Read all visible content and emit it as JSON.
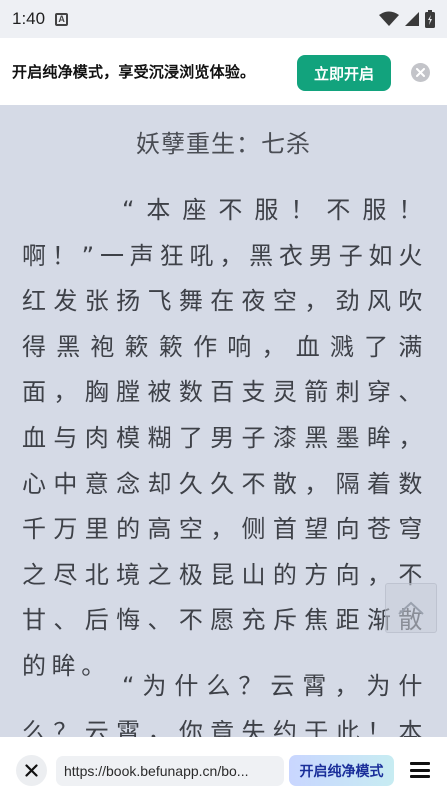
{
  "status_bar": {
    "time": "1:40",
    "notification_icon_letter": "A",
    "icons": [
      "wifi-icon",
      "signal-icon",
      "battery-icon"
    ]
  },
  "promo": {
    "text": "开启纯净模式，享受沉浸浏览体验。",
    "button_label": "立即开启",
    "accent_color": "#12a37d"
  },
  "reader": {
    "chapter_title": "妖孽重生：七杀",
    "paragraphs": [
      "“本座不服！不服！啊！”一声狂吼，黑衣男子如火红发张扬飞舞在夜空，劲风吹得黑袍簌簌作响，血溅了满面，胸膛被数百支灵箭刺穿、血与肉模糊了男子漆黑墨眸，心中意念却久久不散，隔着数千万里的高空，侧首望向苍穹之尽北境之极昆山的方向，不甘、后悔、不愿充斥焦距渐散的眸。",
      "“为什么？云霄，为什么？云霄，你竟失约于此！本座"
    ],
    "background_color": "#d5dae6"
  },
  "bottom_bar": {
    "url": "https://book.befunapp.cn/bo...",
    "pure_mode_label": "开启纯净模式"
  }
}
